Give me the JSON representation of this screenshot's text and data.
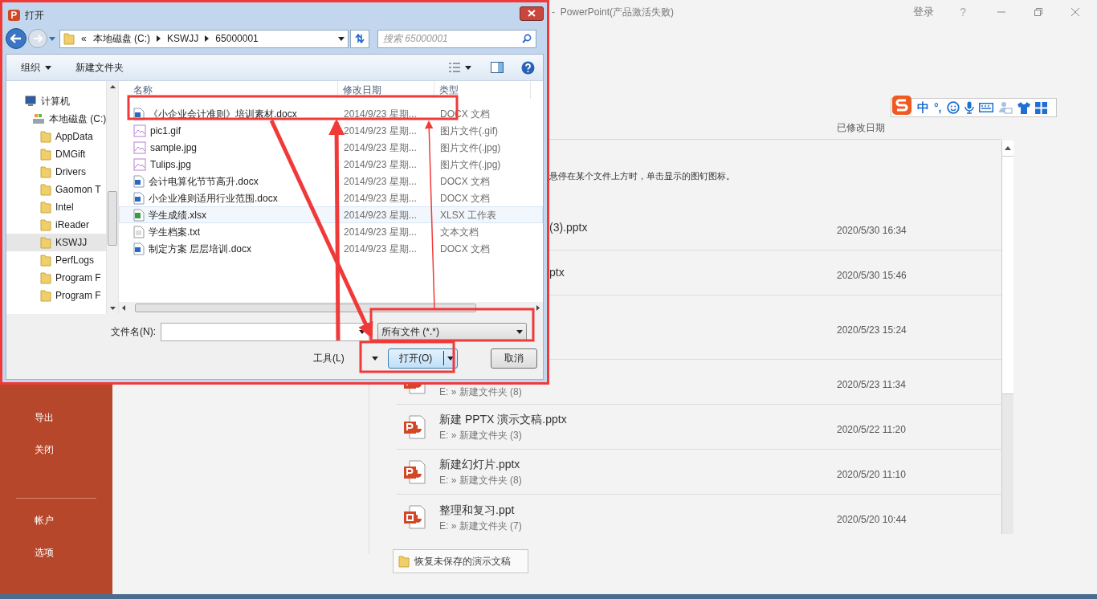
{
  "app_window": {
    "title": "-  PowerPoint(产品激活失败)",
    "sign_in": "登录",
    "help": "?"
  },
  "backstage_nav": {
    "upper_items": [
      {
        "label": "导出"
      },
      {
        "label": "关闭"
      }
    ],
    "lower_items": [
      {
        "label": "帐户"
      },
      {
        "label": "选项"
      }
    ]
  },
  "recent": {
    "column_header": "已修改日期",
    "hint": "悬停在某个文件上方时，单击显示的图钉图标。",
    "files": [
      {
        "name": "(3).pptx",
        "date": "2020/5/30 16:34"
      },
      {
        "name": "ptx",
        "date": "2020/5/30 15:46"
      },
      {
        "date": "2020/5/23 15:24"
      },
      {
        "kind": "pptx",
        "path": "E: » 新建文件夹 (8)",
        "date": "2020/5/23 11:34"
      },
      {
        "kind": "pptx",
        "name": "新建 PPTX 演示文稿.pptx",
        "path": "E: » 新建文件夹 (3)",
        "date": "2020/5/22 11:20"
      },
      {
        "kind": "pptx",
        "name": "新建幻灯片.pptx",
        "path": "E: » 新建文件夹 (8)",
        "date": "2020/5/20 11:10"
      },
      {
        "kind": "ppt",
        "name": "整理和复习.ppt",
        "path": "E: » 新建文件夹 (7)",
        "date": "2020/5/20 10:44"
      }
    ],
    "recover_button": "恢复未保存的演示文稿"
  },
  "ime_toolbar": {
    "mode": "中",
    "punctuation": "°,"
  },
  "dialog": {
    "title": "打开",
    "overflow": "«",
    "breadcrumb": [
      "本地磁盘 (C:)",
      "KSWJJ",
      "65000001"
    ],
    "search_placeholder": "搜索 65000001",
    "toolbar": {
      "organize": "组织",
      "new_folder": "新建文件夹"
    },
    "tree": [
      {
        "label": "计算机",
        "kind": "computer",
        "selected": false,
        "children": [
          {
            "label": "本地磁盘 (C:)",
            "kind": "drive",
            "selected": false,
            "children": [
              {
                "label": "AppData",
                "kind": "folder",
                "selected": false
              },
              {
                "label": "DMGift",
                "kind": "folder",
                "selected": false
              },
              {
                "label": "Drivers",
                "kind": "folder",
                "selected": false
              },
              {
                "label": "Gaomon T",
                "kind": "folder",
                "selected": false
              },
              {
                "label": "Intel",
                "kind": "folder",
                "selected": false
              },
              {
                "label": "iReader",
                "kind": "folder",
                "selected": false
              },
              {
                "label": "KSWJJ",
                "kind": "folder",
                "selected": true
              },
              {
                "label": "PerfLogs",
                "kind": "folder",
                "selected": false
              },
              {
                "label": "Program F",
                "kind": "folder",
                "selected": false
              },
              {
                "label": "Program F",
                "kind": "folder",
                "selected": false
              }
            ]
          }
        ]
      }
    ],
    "columns": [
      "名称",
      "修改日期",
      "类型"
    ],
    "files": [
      {
        "name": "《小企业会计准则》培训素材.docx",
        "date": "2014/9/23 星期...",
        "type": "DOCX 文档",
        "kind": "word",
        "selected": false
      },
      {
        "name": "pic1.gif",
        "date": "2014/9/23 星期...",
        "type": "图片文件(.gif)",
        "kind": "image",
        "selected": false
      },
      {
        "name": "sample.jpg",
        "date": "2014/9/23 星期...",
        "type": "图片文件(.jpg)",
        "kind": "image",
        "selected": false
      },
      {
        "name": "Tulips.jpg",
        "date": "2014/9/23 星期...",
        "type": "图片文件(.jpg)",
        "kind": "image",
        "selected": false
      },
      {
        "name": "会计电算化节节高升.docx",
        "date": "2014/9/23 星期...",
        "type": "DOCX 文档",
        "kind": "word",
        "selected": false
      },
      {
        "name": "小企业准则适用行业范围.docx",
        "date": "2014/9/23 星期...",
        "type": "DOCX 文档",
        "kind": "word",
        "selected": false
      },
      {
        "name": "学生成绩.xlsx",
        "date": "2014/9/23 星期...",
        "type": "XLSX 工作表",
        "kind": "excel",
        "selected": true
      },
      {
        "name": "学生档案.txt",
        "date": "2014/9/23 星期...",
        "type": "文本文档",
        "kind": "text",
        "selected": false
      },
      {
        "name": "制定方案 层层培训.docx",
        "date": "2014/9/23 星期...",
        "type": "DOCX 文档",
        "kind": "word",
        "selected": false
      }
    ],
    "filename_label": "文件名(N):",
    "file_type_filter": "所有文件 (*.*)",
    "tools": "工具(L)",
    "open_button": "打开(O)",
    "cancel_button": "取消"
  }
}
